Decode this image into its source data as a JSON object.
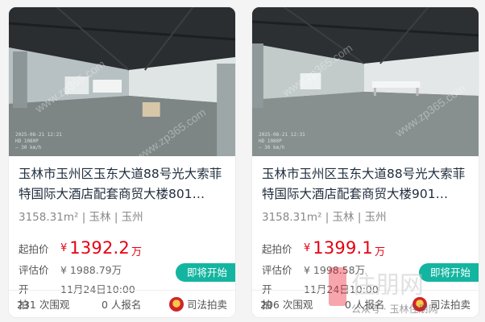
{
  "listings": [
    {
      "title": "玉林市玉州区玉东大道88号光大索菲特国际大酒店配套商贸大楼801…",
      "area": "3158.31m²",
      "city": "玉林",
      "district": "玉州",
      "start_price_label": "起拍价",
      "currency": "¥",
      "start_price": "1392.2",
      "start_price_unit": "万",
      "eval_label": "评估价",
      "eval_price": "¥ 1988.79万",
      "start_label": "开拍",
      "start_time": "11月24日10:00",
      "status_badge": "即将开始",
      "views": "231 次围观",
      "bids": "0 人报名",
      "source": "司法拍卖",
      "photo_stamp": "2025-08-21 12:21\nHD 1080P\n— 30 km/h"
    },
    {
      "title": "玉林市玉州区玉东大道88号光大索菲特国际大酒店配套商贸大楼901…",
      "area": "3158.31m²",
      "city": "玉林",
      "district": "玉州",
      "start_price_label": "起拍价",
      "currency": "¥",
      "start_price": "1399.1",
      "start_price_unit": "万",
      "eval_label": "评估价",
      "eval_price": "¥ 1998.58万",
      "start_label": "开拍",
      "start_time": "11月24日10:00",
      "status_badge": "即将开始",
      "views": "206 次围观",
      "bids": "0 人报名",
      "source": "司法拍卖",
      "photo_stamp": "2025-08-21 12:31\nHD 1080P\n— 30 km/h"
    }
  ],
  "watermark": "www.zp365.com",
  "overlay_brand": "住朋网",
  "overlay_account": "公众号 · 玉林住朋网",
  "colors": {
    "price_red": "#e60012",
    "badge_teal": "#13b5a0"
  }
}
